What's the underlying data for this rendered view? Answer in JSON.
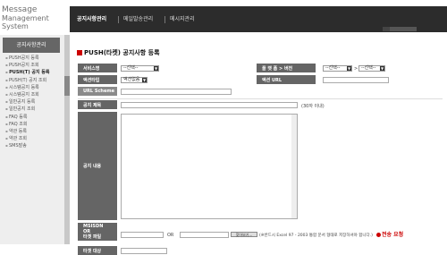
{
  "logo": {
    "line1": "Message",
    "line2": "Management System"
  },
  "gnb": {
    "tabs": [
      "공지사항관리",
      "메일발송관리",
      "메시지관리"
    ]
  },
  "sidebar": {
    "title": "공지사항관리",
    "items": [
      "PUSH공지 등록",
      "PUSH공지 조회",
      "PUSH(T) 공지 등록",
      "PUSH(T) 공지 조회",
      "시스템공지 등록",
      "시스템공지 조회",
      "일반공지 등록",
      "일반공지 조회",
      "FAQ 등록",
      "FAQ 조회",
      "약관 등록",
      "약관 조회",
      "SMS발송"
    ]
  },
  "page": {
    "title": "PUSH(타켓) 공지사항 등록"
  },
  "form": {
    "service_label": "서비스명",
    "service_select": "--선택--",
    "os_label": "플 랫 폼 > 버전",
    "os_select": "--선택--",
    "os_sep": ">",
    "ver_select": "--선택--",
    "action_type_label": "액션타입",
    "action_type_select": "액션없음",
    "action_url_label": "액션 URL",
    "url_scheme_label": "URL Scheme",
    "subject_label": "공지 제목",
    "subject_hint": "(30자 이내)",
    "content_label": "공지 내용",
    "msisdn_label": "MSISDN\nOR\n타겟 파일",
    "or_text": "OR",
    "browse_button": "찾아보기...",
    "file_hint": "(※반드시 Excel 97 - 2003 통합 문서 형태로 저장하셔야 합니다.)",
    "target_count_label": "타겟 대상",
    "send_button": "전송 요청"
  }
}
